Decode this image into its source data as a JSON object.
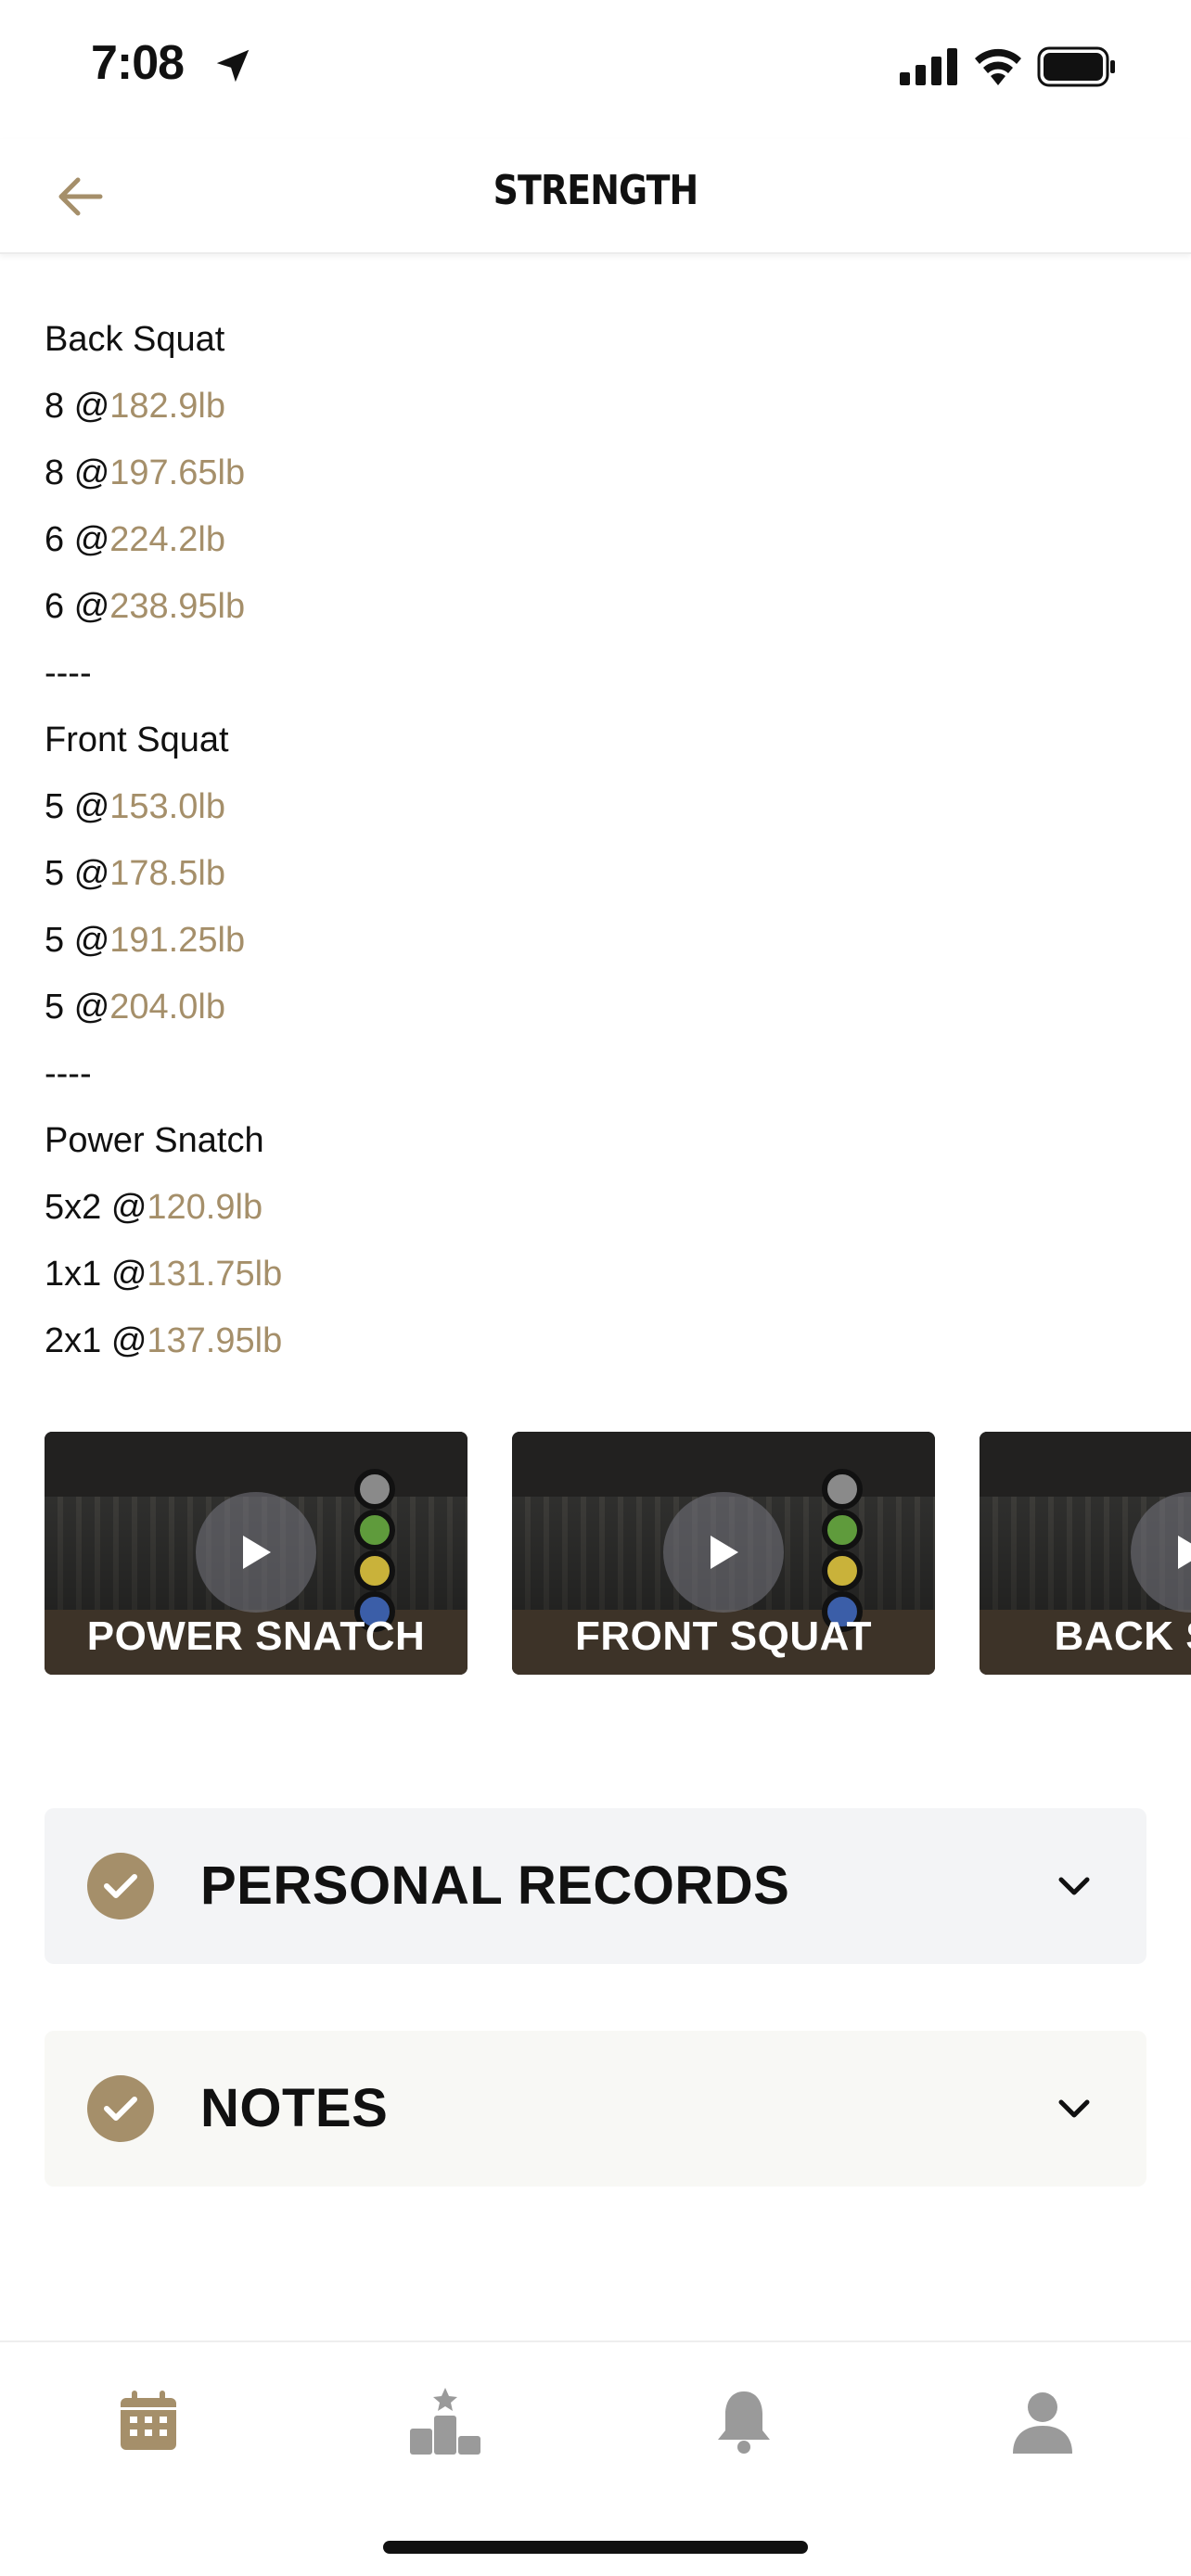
{
  "status_bar": {
    "time": "7:08"
  },
  "header": {
    "title": "STRENGTH",
    "back_icon": "arrow-left-icon"
  },
  "workout_lines": [
    {
      "prefix": "Back Squat",
      "weight": ""
    },
    {
      "prefix": "8 @",
      "weight": "182.9lb"
    },
    {
      "prefix": "8 @",
      "weight": "197.65lb"
    },
    {
      "prefix": "6 @",
      "weight": "224.2lb"
    },
    {
      "prefix": "6 @",
      "weight": "238.95lb"
    },
    {
      "prefix": "----",
      "weight": ""
    },
    {
      "prefix": "Front Squat",
      "weight": ""
    },
    {
      "prefix": "5 @",
      "weight": "153.0lb"
    },
    {
      "prefix": "5 @",
      "weight": "178.5lb"
    },
    {
      "prefix": "5 @",
      "weight": "191.25lb"
    },
    {
      "prefix": "5 @",
      "weight": "204.0lb"
    },
    {
      "prefix": "----",
      "weight": ""
    },
    {
      "prefix": "Power Snatch",
      "weight": ""
    },
    {
      "prefix": "5x2 @",
      "weight": "120.9lb"
    },
    {
      "prefix": "1x1 @",
      "weight": "131.75lb"
    },
    {
      "prefix": "2x1 @",
      "weight": "137.95lb"
    }
  ],
  "videos": [
    {
      "label": "POWER SNATCH"
    },
    {
      "label": "FRONT SQUAT"
    },
    {
      "label": "BACK SQUAT"
    }
  ],
  "sections": {
    "personal_records": "PERSONAL RECORDS",
    "notes": "NOTES"
  },
  "tabs": [
    {
      "icon": "calendar-icon",
      "active": true
    },
    {
      "icon": "podium-icon",
      "active": false
    },
    {
      "icon": "bell-icon",
      "active": false
    },
    {
      "icon": "profile-icon",
      "active": false
    }
  ],
  "colors": {
    "accent": "#a58f6a",
    "inactive_icon": "#9a9a9a",
    "records_bg": "#f3f4f6",
    "notes_bg": "#f8f8f5"
  }
}
